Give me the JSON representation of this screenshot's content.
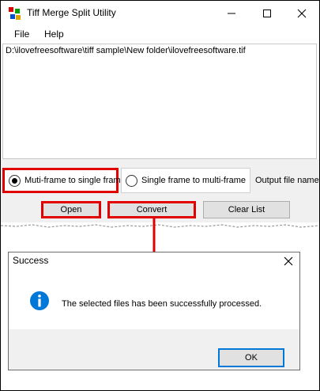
{
  "window": {
    "title": "Tiff Merge Split Utility",
    "icons": {
      "app": "tiff-merge-app-icon",
      "minimize": "minimize-icon",
      "maximize": "maximize-icon",
      "close": "close-icon"
    }
  },
  "menu": {
    "items": [
      {
        "label": "File"
      },
      {
        "label": "Help"
      }
    ]
  },
  "file_list": {
    "items": [
      "D:\\ilovefreesoftware\\tiff sample\\New folder\\ilovefreesoftware.tif"
    ]
  },
  "options": {
    "multi_to_single_label": "Muti-frame to single frame",
    "single_to_multi_label": "Single frame to multi-frame",
    "selected": "multi_to_single",
    "output_label": "Output file name"
  },
  "buttons": {
    "open": "Open",
    "convert": "Convert",
    "clear_list": "Clear List"
  },
  "dialog": {
    "title": "Success",
    "message": "The selected files has been successfully processed.",
    "ok": "OK",
    "icon": "info-icon"
  },
  "colors": {
    "highlight": "#e00000",
    "info_blue": "#0078d7"
  }
}
